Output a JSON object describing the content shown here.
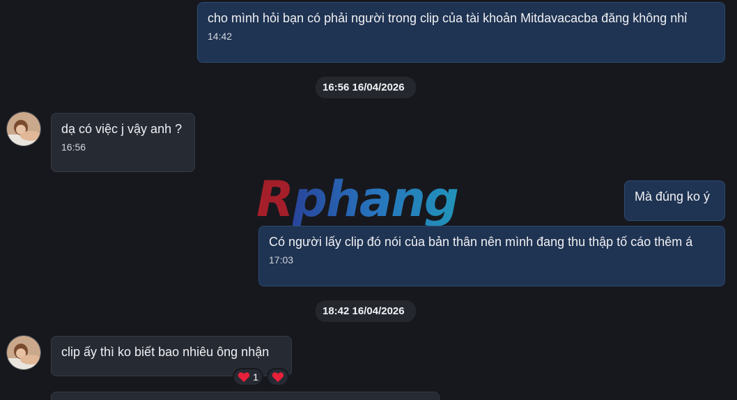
{
  "messages": [
    {
      "direction": "out",
      "text": "cho mình hỏi bạn có phải người trong clip của tài khoản Mitdavacacba đăng không nhỉ",
      "time": "14:42"
    },
    {
      "direction": "in",
      "text": "dạ có việc j vậy anh ?",
      "time": "16:56"
    },
    {
      "direction": "out",
      "text": "Mà đúng ko ý",
      "time": ""
    },
    {
      "direction": "out",
      "text": "Có người lấy clip đó nói của bản thân nên mình đang thu thập tố cáo thêm á",
      "time": "17:03"
    },
    {
      "direction": "in",
      "text": "clip ấy thì ko biết bao nhiêu ông nhận",
      "time": ""
    }
  ],
  "separators": [
    "16:56 16/04/2026",
    "18:42 16/04/2026"
  ],
  "reactions": {
    "heart_count": "1",
    "emoji": "heart-icon"
  },
  "watermark": {
    "first": "R",
    "rest": "phang"
  },
  "colors": {
    "background": "#17181d",
    "outgoing_bubble": "#1f3352",
    "incoming_bubble": "#262a33",
    "heart": "#e8203a"
  }
}
